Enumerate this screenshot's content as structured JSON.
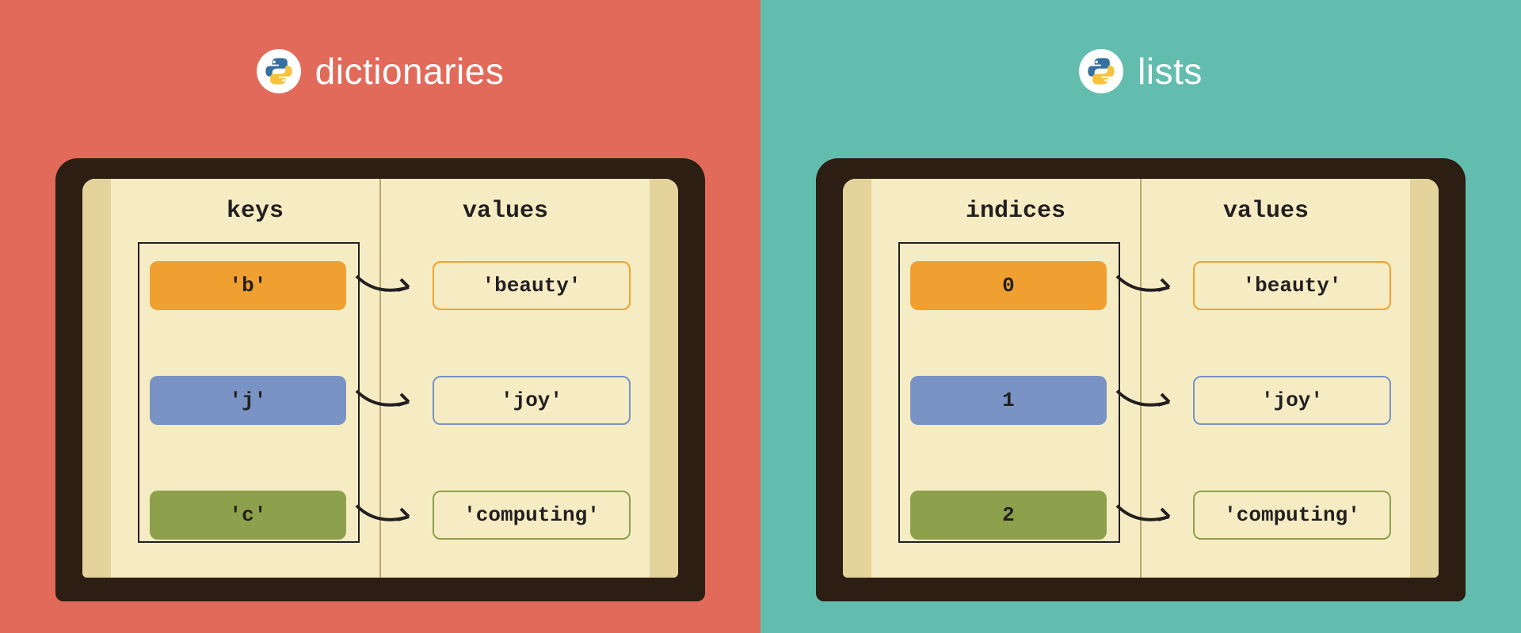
{
  "left": {
    "bg": "#E26A5A",
    "title": "dictionaries",
    "headers": {
      "left": "keys",
      "right": "values"
    },
    "rows": [
      {
        "key": "'b'",
        "value": "'beauty'",
        "color": "orange"
      },
      {
        "key": "'j'",
        "value": "'joy'",
        "color": "blue"
      },
      {
        "key": "'c'",
        "value": "'computing'",
        "color": "green"
      }
    ]
  },
  "right": {
    "bg": "#62BDAE",
    "title": "lists",
    "headers": {
      "left": "indices",
      "right": "values"
    },
    "rows": [
      {
        "key": "0",
        "value": "'beauty'",
        "color": "orange"
      },
      {
        "key": "1",
        "value": "'joy'",
        "color": "blue"
      },
      {
        "key": "2",
        "value": "'computing'",
        "color": "green"
      }
    ]
  },
  "colors": {
    "orange": "#F0A030",
    "blue": "#7893C4",
    "green": "#8DA04B",
    "page": "#F6ECC4",
    "cover": "#2C1E12"
  }
}
